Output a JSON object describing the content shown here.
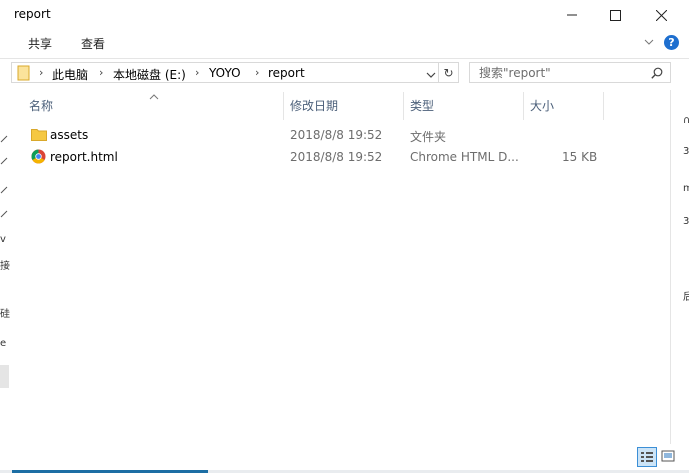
{
  "window": {
    "title": "report"
  },
  "ribbon": {
    "tabs": [
      "共享",
      "查看"
    ]
  },
  "address": {
    "crumbs": [
      "此电脑",
      "本地磁盘 (E:)",
      "YOYO",
      "report"
    ]
  },
  "search": {
    "placeholder": "搜索\"report\""
  },
  "columns": [
    "名称",
    "修改日期",
    "类型",
    "大小"
  ],
  "files": [
    {
      "name": "assets",
      "date": "2018/8/8 19:52",
      "type": "文件夹",
      "size": "",
      "icon": "folder-icon"
    },
    {
      "name": "report.html",
      "date": "2018/8/8 19:52",
      "type": "Chrome HTML D...",
      "size": "15 KB",
      "icon": "chrome-icon"
    }
  ],
  "nav_fragments": [
    "v",
    "接",
    "硅",
    "e"
  ],
  "right_fragments": [
    "∩",
    "3",
    "m",
    "3",
    "后"
  ],
  "colors": {
    "accent": "#1c6ea4",
    "folder": "#f5c842",
    "help": "#1e6fcf"
  }
}
